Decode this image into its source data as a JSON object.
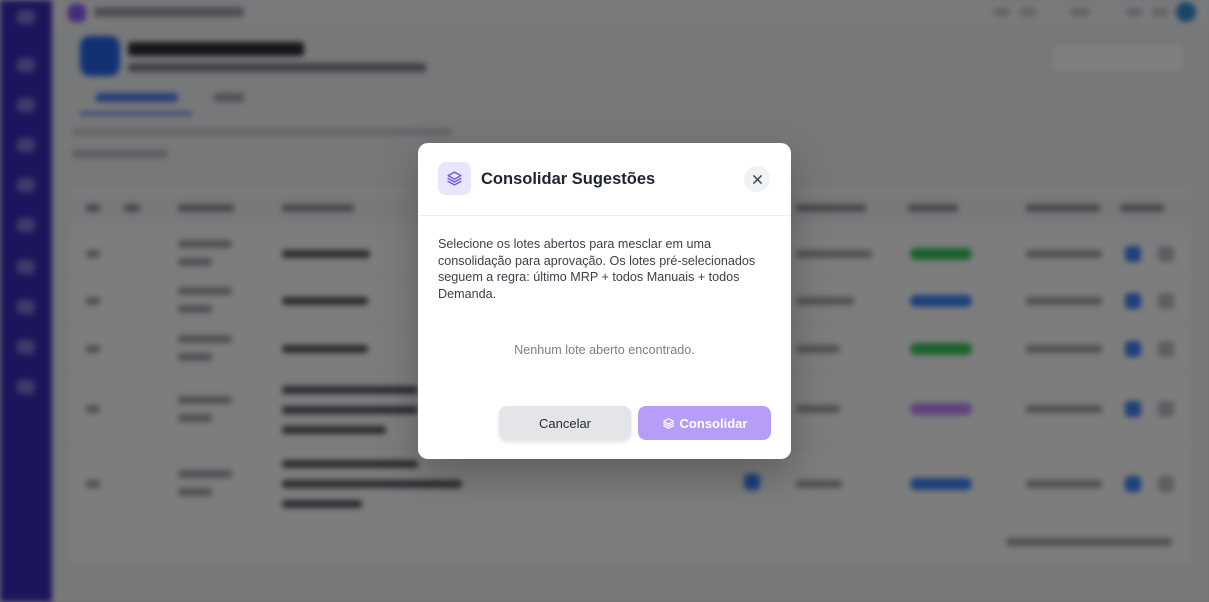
{
  "modal": {
    "title": "Consolidar Sugestões",
    "description": "Selecione os lotes abertos para mesclar em uma consolidação para aprovação. Os lotes pré-selecionados seguem a regra: último MRP + todos Manuais + todos Demanda.",
    "empty_message": "Nenhum lote aberto encontrado.",
    "cancel_label": "Cancelar",
    "confirm_label": "Consolidar",
    "header_icon": "layers-icon",
    "close_icon": "close-icon",
    "confirm_icon": "layers-icon"
  },
  "colors": {
    "accent": "#8b5cf6",
    "confirm_button": "#b79cf8",
    "sidebar": "#3a2bb8",
    "status_green": "#34c759",
    "status_blue": "#3b82f6",
    "status_purple": "#c084fc"
  }
}
